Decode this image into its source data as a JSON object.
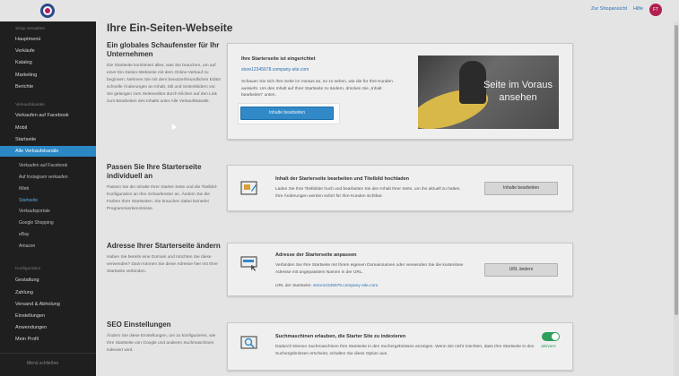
{
  "topbar": {
    "link_storefront": "Zur Shopansicht",
    "link_help": "Hilfe",
    "avatar_initials": "FT"
  },
  "sidebar": {
    "section_shop": "Shop verwalten",
    "items_shop": [
      "Hauptmenü",
      "Verkäufe",
      "Katalog",
      "Marketing",
      "Berichte"
    ],
    "section_channels": "Verkaufskanäle",
    "items_channels": [
      "Verkaufen auf Facebook",
      "Mobil",
      "Startseite"
    ],
    "active_item": "Alle Verkaufskanäle",
    "subitems": [
      "Verkaufen auf Facebook",
      "Auf Instagram verkaufen",
      "iWeb",
      "Startseite",
      "Verkaufsportale",
      "Google Shopping",
      "eBay",
      "Amazon"
    ],
    "section_config": "Konfiguration",
    "items_config": [
      "Gestaltung",
      "Zahlung",
      "Versand & Abholung",
      "Einstellungen",
      "Anwendungen",
      "Mein Profil"
    ],
    "bottom_label": "Menü schließen"
  },
  "page": {
    "title": "Ihre Ein-Seiten-Webseite"
  },
  "sections": [
    {
      "title": "Ein globales Schaufenster für Ihr Unternehmen",
      "description": "Die Startseite kombiniert alles, was Sie brauchen, um auf einer Ein-Seiten-Webseite mit dem Online-Verkauf zu beginnen. Nehmen Sie mit dem benutzerfreundlichen Editor schnelle Änderungen an Inhalt, Stil und Seitenbildern vor. Sie gelangen zum Seiteneditor durch Klicken auf den Link zum Bearbeiten des Inhalts unter Alle Verkaufskanäle.",
      "card_title": "Ihre Starterseite ist eingerichtet",
      "card_link": "store12345678.company-site.com",
      "card_text": "Schauen Sie sich Ihre Seite im Voraus an, so zu sehen, wie die für Ihre Kunden aussieht. Um den Inhalt auf Ihrer Startseite zu ändern, drücken Sie „Inhalt bearbeiten“ unten.",
      "button": "Inhalte bearbeiten",
      "preview_label": "Seite im Voraus ansehen"
    },
    {
      "title": "Passen Sie Ihre Starterseite individuell an",
      "description": "Passen Sie die Inhalte Ihrer Starter-Seite und die Titelbild-Konfiguration an Ihre Schaufenster an. Ändern Sie die Farben Ihrer Startseiten. Sie brauchen dabei keinerlei Programmierkenntnisse.",
      "card_title": "Inhalt der Starterseite bearbeiten und Titelbild hochladen",
      "card_text": "Laden Sie Ihre Titelbilder hoch und bearbeiten Sie den Inhalt Ihrer Seite, um ihn aktuell zu halten. Ihre Änderungen werden sofort für Ihre Kunden sichtbar.",
      "button": "Inhalte bearbeiten",
      "icon": "edit-image-icon"
    },
    {
      "title": "Adresse Ihrer Starterseite ändern",
      "description": "Haben Sie bereits eine Domain und möchten Sie diese verwenden? Dann können Sie diese Adresse hier mit Ihrer Startseite verbinden.",
      "card_title": "Adresse der Starterseite anpassen",
      "card_text": "Verbinden Sie Ihre Startseite mit Ihrem eigenen Domainnamen oder verwenden Sie die kostenlose Adresse mit angepasstem Namen in der URL.",
      "card_url_label": "URL der Startseite:",
      "card_url": "store12345678.company-site.com",
      "button": "URL ändern",
      "icon": "web-address-icon"
    },
    {
      "title": "SEO Einstellungen",
      "description": "Ändern Sie diese Einstellungen, um zu konfigurieren, wie Ihre Startseite von Google und anderen Suchmaschinen indexiert wird.",
      "card_title": "Suchmaschinen erlauben, die Starter Site zu indexieren",
      "card_text": "Dadurch können Suchmaschinen Ihre Startseite in den Suchergebnissen anzeigen. Wenn Sie nicht möchten, dass Ihre Startseite in den Suchergebnissen erscheint, schalten Sie diese Option aus.",
      "toggle_label": "aktiviert",
      "toggle_on": true,
      "icon": "search-engine-icon"
    }
  ],
  "colors": {
    "accent": "#3189c8",
    "sidebar_bg": "#1f1f1f",
    "toggle_on": "#2e9e5b",
    "avatar": "#b0204f"
  }
}
